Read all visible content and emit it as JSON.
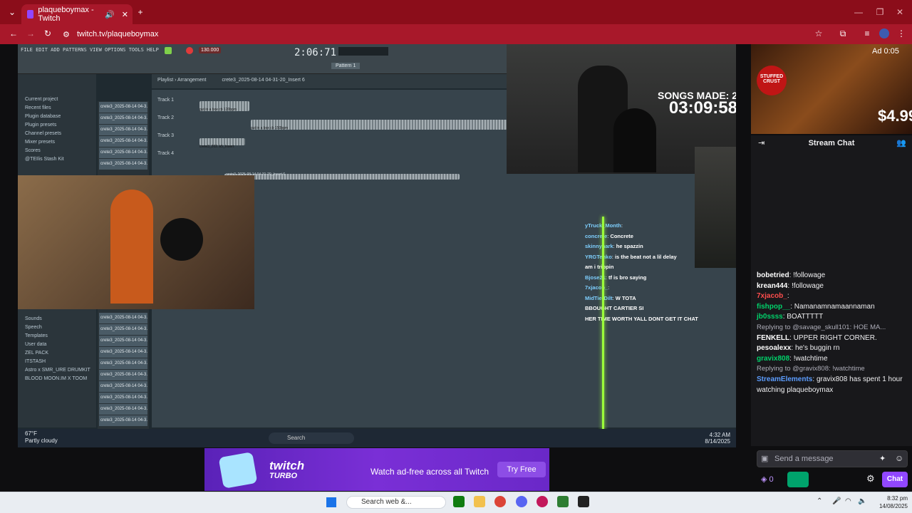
{
  "browser": {
    "tab_title": "plaqueboymax - Twitch",
    "url": "twitch.tv/plaqueboymax",
    "new_tab": "+"
  },
  "fl": {
    "menu": "FILE EDIT ADD PATTERNS VIEW OPTIONS TOOLS HELP",
    "tempo": "130.000",
    "time": "2:06:71",
    "pattern": "Pattern 1",
    "playlist_title": "Playlist › Arrangement",
    "project_name": "crete3_2025-08-14 04-31-20_Insert 6",
    "browser_items": [
      "Current project",
      "Recent files",
      "Plugin database",
      "Plugin presets",
      "Channel presets",
      "Mixer presets",
      "Scores",
      "@TEIlis Stash Kit"
    ],
    "browser_items2": [
      "Sounds",
      "Speech",
      "Templates",
      "User data",
      "ZEL PACK",
      "ITSTASH",
      "Astro x SMR_URE DRUMKIT",
      "BLOOD MOON.IM X TOOM"
    ],
    "pattern_items": [
      "crete3_2025-08-14 04-3..",
      "crete3_2025-08-14 04-3..",
      "crete3_2025-08-14 04-3..",
      "crete3_2025-08-14 04-3..",
      "crete3_2025-08-14 04-3..",
      "crete3_2025-08-14 04-3.."
    ],
    "pattern_items2": [
      "crete3_2025-08-14 04-3..",
      "crete3_2025-08-14 04-3..",
      "crete3_2025-08-14 04-3..",
      "crete3_2025-08-14 04-3..",
      "crete3_2025-08-14 04-3..",
      "crete3_2025-08-14 04-3..",
      "crete3_2025-08-14 04-3..",
      "crete3_2025-08-14 04-3..",
      "crete3_2025-08-14 04-3..",
      "crete3_2025-08-14 04-3.."
    ],
    "tracks": [
      "Track 1",
      "Track 2",
      "Track 3",
      "Track 4"
    ],
    "clip1": "put in a box cb 120bpm",
    "clip2": "put in a box cb 150bpm",
    "clip3": "crete3_202..k5_Insert",
    "clip4": "crete3_2025-08-14 04-31-20_Insert 6"
  },
  "stream_overlay": {
    "songs_made": "SONGS MADE: 2",
    "timer": "03:09:58",
    "chat": [
      {
        "user": "yTruck_Month",
        "msg": ""
      },
      {
        "user": "concrete",
        "msg": "Concrete"
      },
      {
        "user": "skinnyhark",
        "msg": "he spazzin"
      },
      {
        "user": "YRGTenko",
        "msg": "is the beat not a lil delay"
      },
      {
        "user": "",
        "msg": "am i trippin"
      },
      {
        "user": "Bjose21",
        "msg": "tf is bro saying"
      },
      {
        "user": "7xjacob_",
        "msg": ""
      },
      {
        "user": "MidTierDilt",
        "msg": "W TOTA"
      },
      {
        "user": "",
        "msg": "BBOUGHT CARTIER SI"
      },
      {
        "user": "",
        "msg": "HER TIME WORTH YALL DONT GET IT CHAT"
      }
    ]
  },
  "windows_inner": {
    "search": "Search",
    "weather_temp": "67°F",
    "weather_desc": "Partly cloudy",
    "time": "4:32 AM",
    "date": "8/14/2025"
  },
  "ad": {
    "label": "Ad 0:05",
    "brand": "STUFFED CRUST",
    "price": "$4.99"
  },
  "chat": {
    "header": "Stream Chat",
    "messages": [
      {
        "user": "bobetried",
        "color": "#ffffff",
        "msg": "!followage"
      },
      {
        "user": "krean444",
        "color": "#ffffff",
        "msg": "!followage"
      },
      {
        "user": "7xjacob_",
        "color": "#ff4d4d",
        "msg": ""
      },
      {
        "user": "fishpop__",
        "color": "#00d26a",
        "msg": "Namanamnamaannaman"
      },
      {
        "user": "jb0ssss",
        "color": "#00d26a",
        "msg": "BOATTTTT"
      },
      {
        "user": "",
        "color": "#adadb8",
        "msg": "Replying to @savage_skull101: HOE MA..."
      },
      {
        "user": "FENKELL",
        "color": "#ffffff",
        "msg": "UPPER RIGHT CORNER."
      },
      {
        "user": "pesoalexx",
        "color": "#ffffff",
        "msg": "he's buggin rn"
      },
      {
        "user": "gravix808",
        "color": "#00d26a",
        "msg": "!watchtime"
      },
      {
        "user": "",
        "color": "#adadb8",
        "msg": "Replying to @gravix808: !watchtime"
      },
      {
        "user": "StreamElements",
        "color": "#5c9dff",
        "msg": "gravix808 has spent 1 hour watching plaqueboymax"
      }
    ],
    "input_placeholder": "Send a message",
    "points": "0",
    "send_label": "Chat"
  },
  "banner": {
    "logo_line1": "twitch",
    "logo_line2": "TURBO",
    "text": "Watch ad-free across all Twitch",
    "button": "Try Free"
  },
  "taskbar": {
    "search_placeholder": "Search web &...",
    "time": "8:32 pm",
    "date": "14/08/2025"
  }
}
